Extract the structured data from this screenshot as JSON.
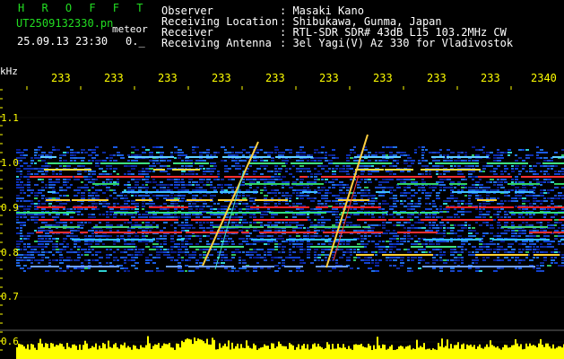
{
  "header": {
    "brand": "H R O F F T",
    "filename": "UT2509132330.pn",
    "tag": "meteor",
    "datetime": "25.09.13 23:30",
    "counter": "0._"
  },
  "info": [
    {
      "label": "Observer",
      "value": ": Masaki Kano"
    },
    {
      "label": "Receiving Location",
      "value": ": Shibukawa, Gunma, Japan"
    },
    {
      "label": "Receiver",
      "value": ": RTL-SDR SDR# 43dB L15 103.2MHz CW"
    },
    {
      "label": "Receiving Antenna",
      "value": ": 3el Yagi(V) Az 330 for Vladivostok"
    }
  ],
  "axis": {
    "unit": "kHz",
    "y_labels": [
      "1.1",
      "1.0",
      "0.9",
      "0.8",
      "0.7",
      "0.6"
    ],
    "x_ticks": [
      "233",
      "233",
      "233",
      "233",
      "233",
      "233",
      "233",
      "233",
      "233",
      "2340"
    ]
  },
  "colors": {
    "text": "#ffffff",
    "accent_green": "#22dd22",
    "axis_yellow": "#ffff00",
    "signal_red": "#ff2020"
  }
}
